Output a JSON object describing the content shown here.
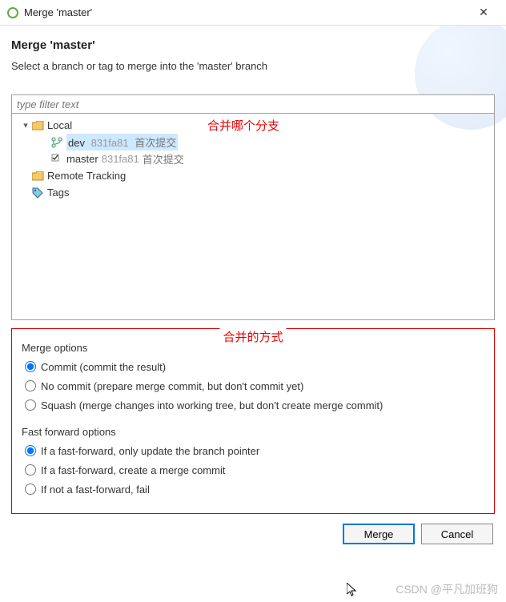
{
  "titlebar": {
    "title": "Merge 'master'"
  },
  "header": {
    "title": "Merge 'master'",
    "description": "Select a branch or tag to merge into the 'master' branch"
  },
  "filter": {
    "placeholder": "type filter text"
  },
  "tree": {
    "local_label": "Local",
    "dev_branch": "dev",
    "dev_hash": "831fa81",
    "dev_msg": "首次提交",
    "master_branch": "master",
    "master_hash": "831fa81",
    "master_msg": "首次提交",
    "remote_label": "Remote Tracking",
    "tags_label": "Tags"
  },
  "annotations": {
    "which_branch": "合并哪个分支",
    "merge_method": "合并的方式"
  },
  "merge_options": {
    "group_label": "Merge options",
    "commit": "Commit (commit the result)",
    "no_commit": "No commit (prepare merge commit, but don't commit yet)",
    "squash": "Squash (merge changes into working tree, but don't create merge commit)"
  },
  "ff_options": {
    "group_label": "Fast forward options",
    "ff_only_update": "If a fast-forward, only update the branch pointer",
    "ff_create_commit": "If a fast-forward, create a merge commit",
    "not_ff_fail": "If not a fast-forward, fail"
  },
  "buttons": {
    "merge": "Merge",
    "cancel": "Cancel"
  },
  "watermark": "CSDN @平凡加班狗"
}
